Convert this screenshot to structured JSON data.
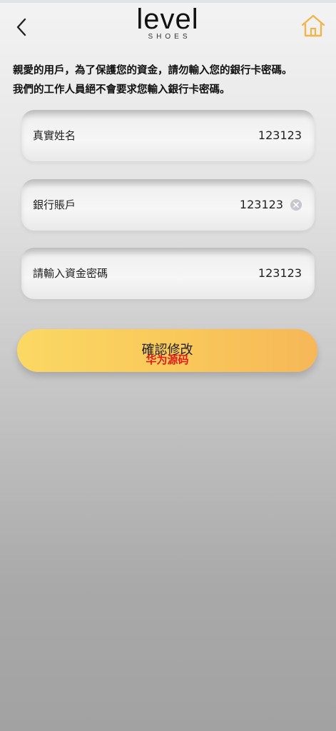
{
  "header": {
    "logo_main": "level",
    "logo_sub": "SHOES"
  },
  "icons": {
    "back": "chevron-left-icon",
    "home": "home-icon",
    "clear": "clear-icon"
  },
  "colors": {
    "accent_start": "#fbd864",
    "accent_end": "#f6b758",
    "home_icon": "#f2b54a",
    "watermark": "#e11c1c"
  },
  "notice": {
    "line1": "親愛的用戶，為了保護您的資金，請勿輸入您的銀行卡密碼。",
    "line2": "我們的工作人員絕不會要求您輸入銀行卡密碼。"
  },
  "form": {
    "real_name": {
      "label": "真實姓名",
      "value": "123123"
    },
    "bank_account": {
      "label": "銀行賬戶",
      "value": "123123"
    },
    "fund_password": {
      "label": "請輸入資金密碼",
      "value": "123123"
    }
  },
  "submit": {
    "label": "確認修改",
    "watermark": "华为源码"
  }
}
